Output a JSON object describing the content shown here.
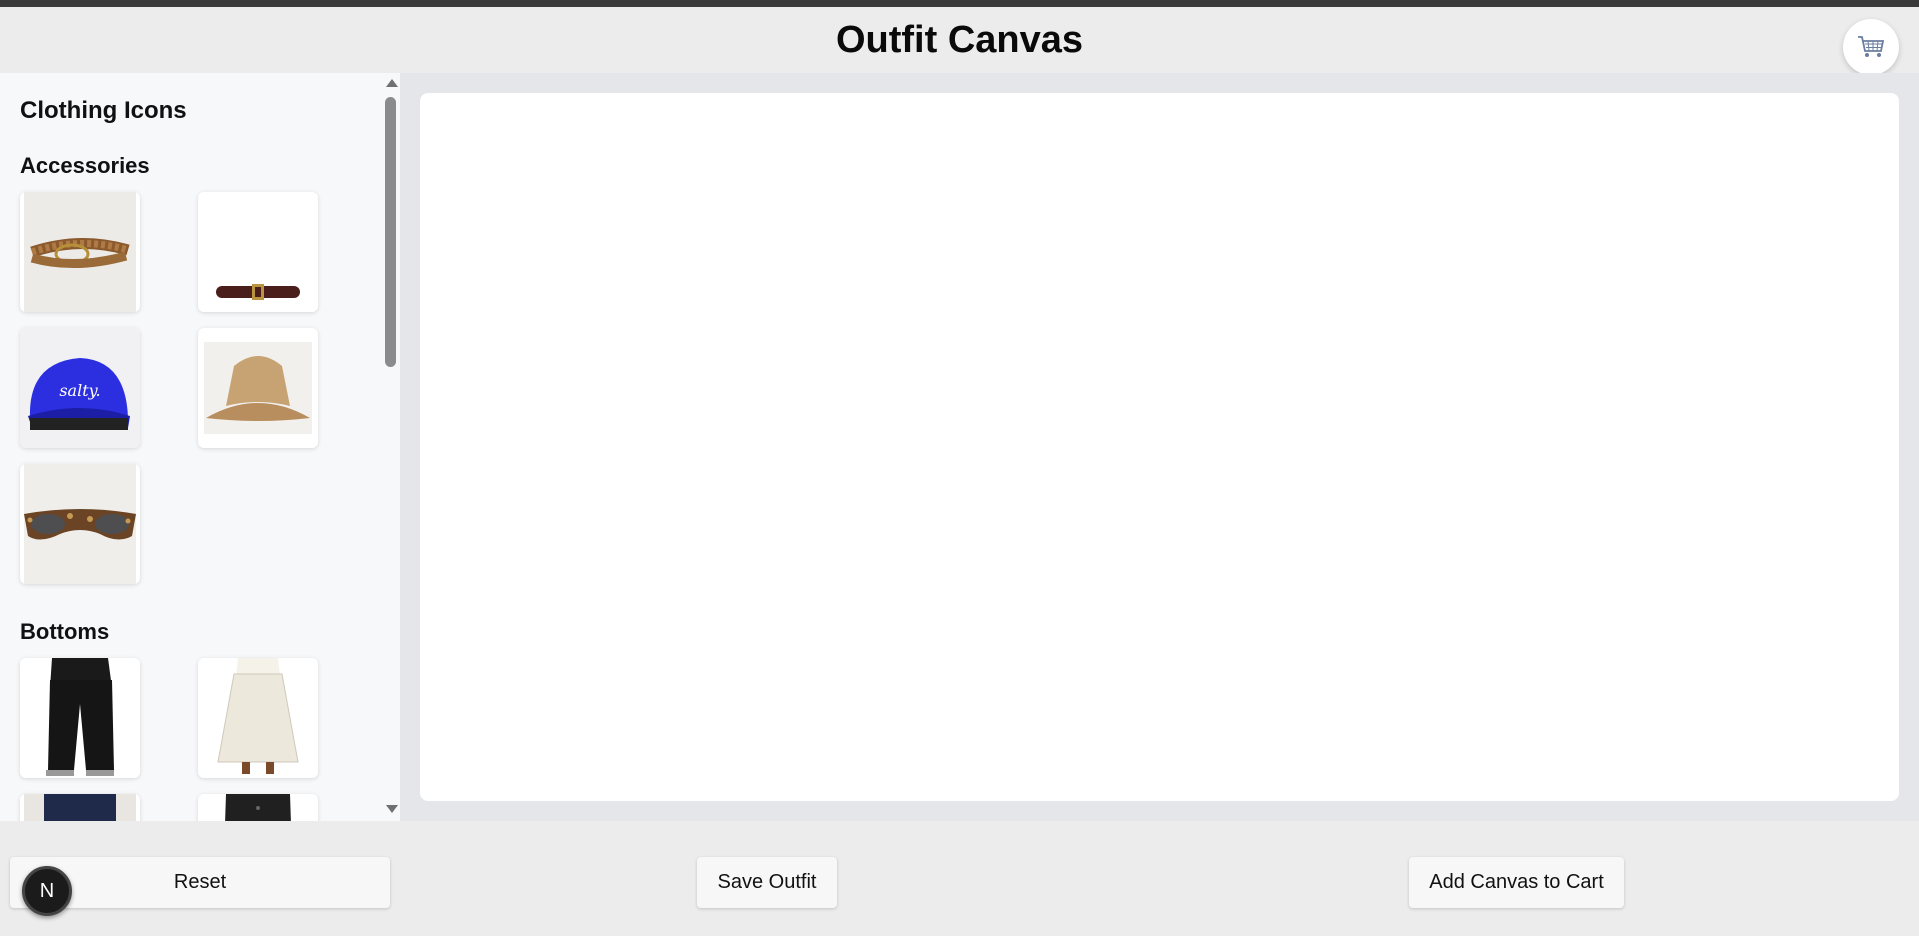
{
  "header": {
    "title": "Outfit Canvas",
    "cart_icon": "cart-icon"
  },
  "sidebar": {
    "title": "Clothing Icons",
    "sections": [
      {
        "name": "Accessories",
        "items": [
          "braided-belt",
          "dark-belt",
          "blue-cap",
          "straw-hat",
          "sunglasses"
        ]
      },
      {
        "name": "Bottoms",
        "items": [
          "black-pants",
          "white-skirt",
          "jeans",
          "black-skirt"
        ]
      }
    ]
  },
  "cap_text": "salty.",
  "footer": {
    "reset_label": "Reset",
    "save_label": "Save Outfit",
    "add_cart_label": "Add Canvas to Cart"
  },
  "badge": {
    "letter": "N"
  }
}
